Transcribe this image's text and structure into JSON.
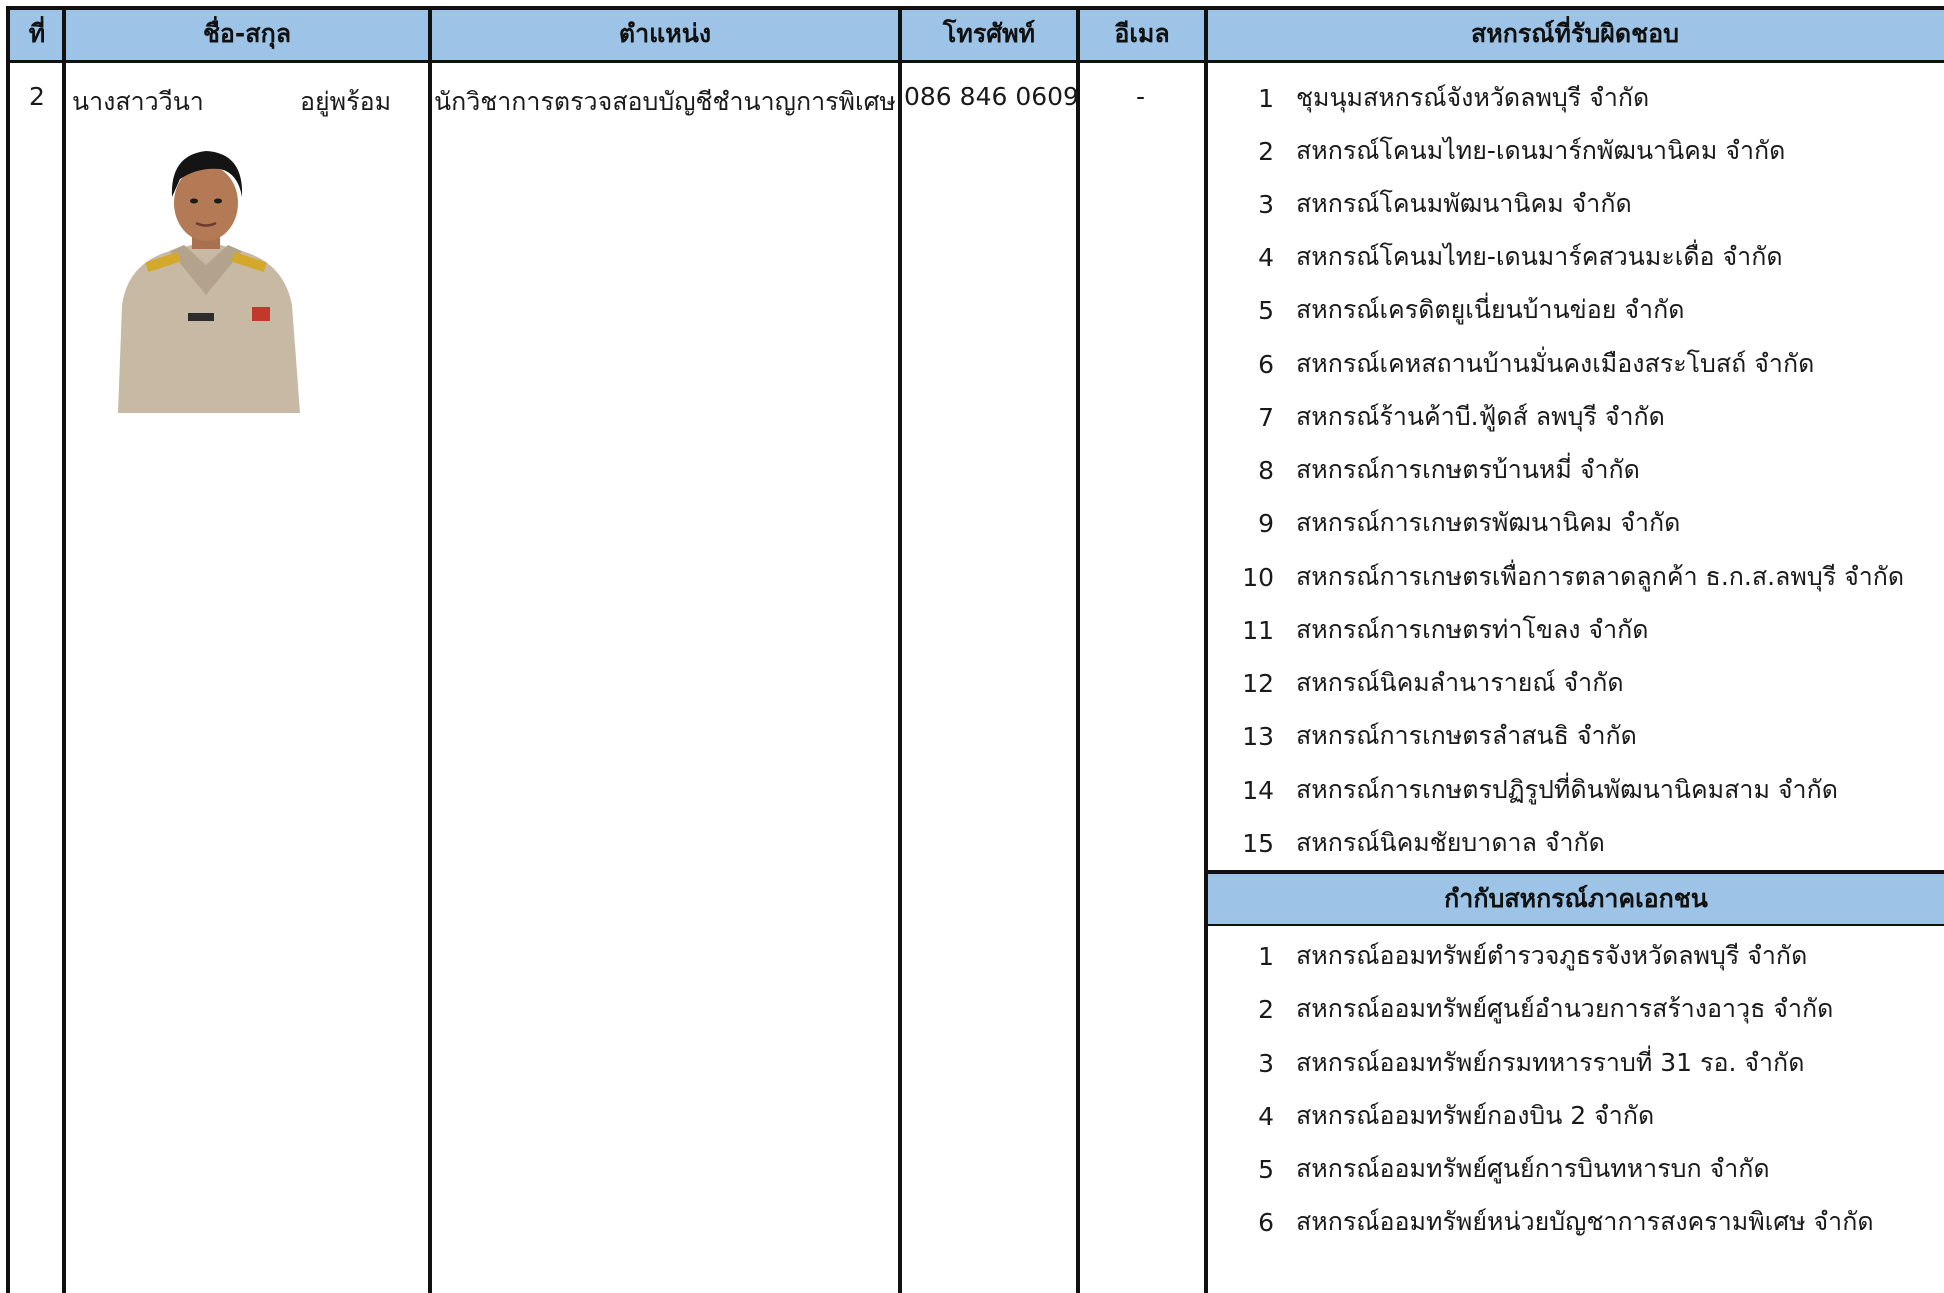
{
  "header": {
    "col_no": "ที่",
    "col_name": "ชื่อ-สกุล",
    "col_position": "ตำแหน่ง",
    "col_phone": "โทรศัพท์",
    "col_email": "อีเมล",
    "col_coops": "สหกรณ์ที่รับผิดชอบ"
  },
  "row": {
    "no": "2",
    "first_name": "นางสาววีนา",
    "last_name": "อยู่พร้อม",
    "position": "นักวิชาการตรวจสอบบัญชีชำนาญการพิเศษ",
    "phone": "086 846 0609",
    "email": "-"
  },
  "coops": [
    {
      "n": "1",
      "name": "ชุมนุมสหกรณ์จังหวัดลพบุรี จำกัด"
    },
    {
      "n": "2",
      "name": "สหกรณ์โคนมไทย-เดนมาร์กพัฒนานิคม จำกัด"
    },
    {
      "n": "3",
      "name": "สหกรณ์โคนมพัฒนานิคม จำกัด"
    },
    {
      "n": "4",
      "name": "สหกรณ์โคนมไทย-เดนมาร์คสวนมะเดื่อ จำกัด"
    },
    {
      "n": "5",
      "name": "สหกรณ์เครดิตยูเนี่ยนบ้านข่อย จำกัด"
    },
    {
      "n": "6",
      "name": "สหกรณ์เคหสถานบ้านมั่นคงเมืองสระโบสถ์ จำกัด"
    },
    {
      "n": "7",
      "name": "สหกรณ์ร้านค้าบี.ฟู้ดส์ ลพบุรี จำกัด"
    },
    {
      "n": "8",
      "name": "สหกรณ์การเกษตรบ้านหมี่ จำกัด"
    },
    {
      "n": "9",
      "name": "สหกรณ์การเกษตรพัฒนานิคม จำกัด"
    },
    {
      "n": "10",
      "name": "สหกรณ์การเกษตรเพื่อการตลาดลูกค้า ธ.ก.ส.ลพบุรี จำกัด"
    },
    {
      "n": "11",
      "name": "สหกรณ์การเกษตรท่าโขลง จำกัด"
    },
    {
      "n": "12",
      "name": "สหกรณ์นิคมลำนารายณ์ จำกัด"
    },
    {
      "n": "13",
      "name": "สหกรณ์การเกษตรลำสนธิ จำกัด"
    },
    {
      "n": "14",
      "name": "สหกรณ์การเกษตรปฏิรูปที่ดินพัฒนานิคมสาม จำกัด"
    },
    {
      "n": "15",
      "name": "สหกรณ์นิคมชัยบาดาล จำกัด"
    }
  ],
  "private_header": "กำกับสหกรณ์ภาคเอกชน",
  "private_coops": [
    {
      "n": "1",
      "name": "สหกรณ์ออมทรัพย์ตำรวจภูธรจังหวัดลพบุรี  จำกัด"
    },
    {
      "n": "2",
      "name": "สหกรณ์ออมทรัพย์ศูนย์อำนวยการสร้างอาวุธ จำกัด"
    },
    {
      "n": "3",
      "name": "สหกรณ์ออมทรัพย์กรมทหารราบที่  31 รอ. จำกัด"
    },
    {
      "n": "4",
      "name": "สหกรณ์ออมทรัพย์กองบิน 2  จำกัด"
    },
    {
      "n": "5",
      "name": "สหกรณ์ออมทรัพย์ศูนย์การบินทหารบก จำกัด"
    },
    {
      "n": "6",
      "name": "สหกรณ์ออมทรัพย์หน่วยบัญชาการสงครามพิเศษ จำกัด"
    }
  ],
  "colors": {
    "header_bg": "#9dc3e6",
    "grid": "#111111"
  }
}
